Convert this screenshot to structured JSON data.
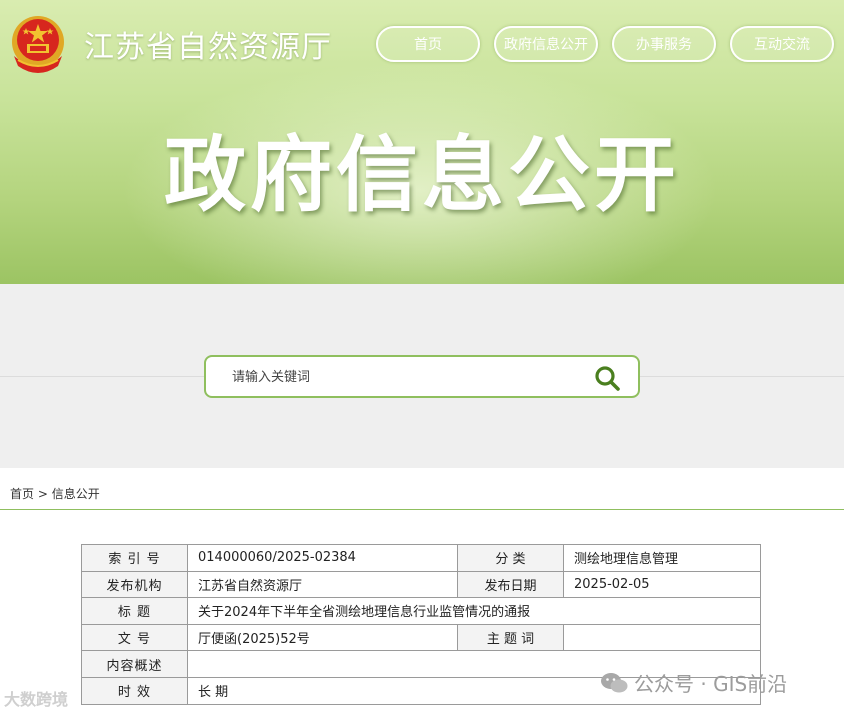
{
  "site": {
    "title": "江苏省自然资源厅"
  },
  "nav": {
    "items": [
      {
        "label": "首页"
      },
      {
        "label": "政府信息公开"
      },
      {
        "label": "办事服务"
      },
      {
        "label": "互动交流"
      }
    ]
  },
  "hero": {
    "title": "政府信息公开"
  },
  "search": {
    "placeholder": "请输入关键词"
  },
  "breadcrumb": {
    "home": "首页",
    "separator": ">",
    "current": "信息公开"
  },
  "info": {
    "index_label": "索 引 号",
    "index_value": "014000060/2025-02384",
    "category_label": "分    类",
    "category_value": "测绘地理信息管理",
    "issuer_label": "发布机构",
    "issuer_value": "江苏省自然资源厅",
    "date_label": "发布日期",
    "date_value": "2025-02-05",
    "title_label": "标    题",
    "title_value": "关于2024年下半年全省测绘地理信息行业监管情况的通报",
    "doc_no_label": "文    号",
    "doc_no_value": "厅便函(2025)52号",
    "subject_label": "主 题 词",
    "subject_value": "",
    "summary_label": "内容概述",
    "summary_value": "",
    "validity_label": "时    效",
    "validity_value": "长 期"
  },
  "watermarks": {
    "right": "公众号 · GIS前沿",
    "left": "大数跨境"
  },
  "colors": {
    "accent_green": "#8fbf5e",
    "search_icon": "#4a7f1f",
    "emblem_red": "#d7261e",
    "emblem_gold": "#f2c230"
  }
}
